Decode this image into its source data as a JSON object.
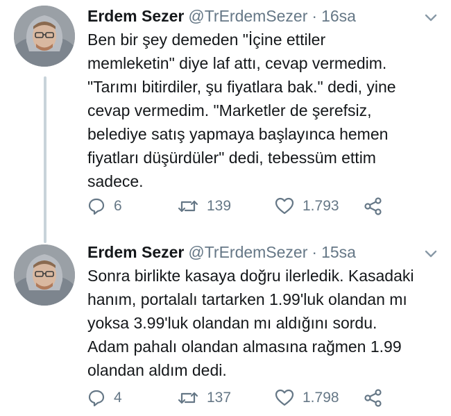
{
  "tweets": [
    {
      "name": "Erdem Sezer",
      "handle": "@TrErdemSezer",
      "separator": "·",
      "time": "16sa",
      "lines": [
        "Ben bir şey demeden \"İçine ettiler",
        "memleketin\" diye laf attı, cevap vermedim.",
        "\"Tarımı bitirdiler, şu fiyatlara bak.\" dedi, yine",
        "cevap vermedim. \"Marketler de şerefsiz,",
        "belediye satış yapmaya başlayınca hemen",
        "fiyatları düşürdüler\" dedi, tebessüm ettim",
        "sadece."
      ],
      "replies": "6",
      "retweets": "139",
      "likes": "1.793",
      "icons": {
        "reply": "reply-icon",
        "retweet": "retweet-icon",
        "like": "heart-icon",
        "share": "share-icon",
        "menu": "chevron-down-icon"
      }
    },
    {
      "name": "Erdem Sezer",
      "handle": "@TrErdemSezer",
      "separator": "·",
      "time": "15sa",
      "lines": [
        "Sonra birlikte kasaya doğru ilerledik. Kasadaki",
        "hanım, portalalı tartarken 1.99'luk olandan mı",
        "yoksa 3.99'luk olandan mı aldığını sordu.",
        "Adam pahalı olandan almasına rağmen 1.99",
        "olandan aldım dedi."
      ],
      "replies": "4",
      "retweets": "137",
      "likes": "1.798",
      "icons": {
        "reply": "reply-icon",
        "retweet": "retweet-icon",
        "like": "heart-icon",
        "share": "share-icon",
        "menu": "chevron-down-icon"
      }
    }
  ],
  "colors": {
    "text": "#14171a",
    "secondary": "#657786",
    "thread_line": "#c8d3da"
  }
}
